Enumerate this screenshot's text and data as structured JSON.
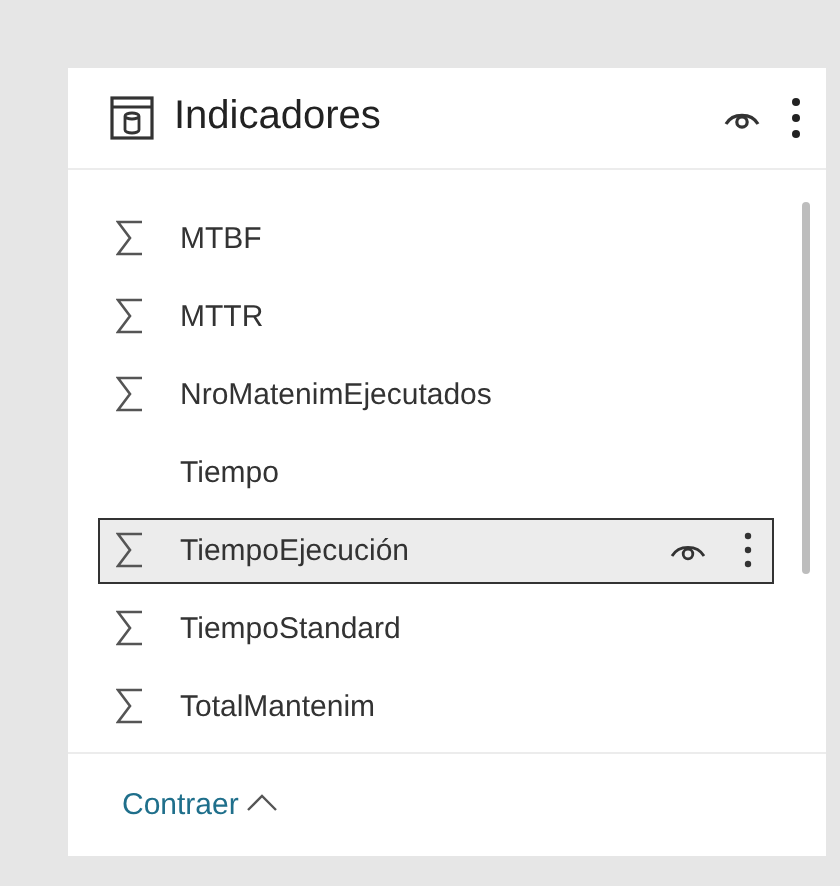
{
  "panel": {
    "title": "Indicadores"
  },
  "fields": [
    {
      "name": "MTBF",
      "kind": "measure",
      "selected": false
    },
    {
      "name": "MTTR",
      "kind": "measure",
      "selected": false
    },
    {
      "name": "NroMatenimEjecutados",
      "kind": "measure",
      "selected": false
    },
    {
      "name": "Tiempo",
      "kind": "column",
      "selected": false
    },
    {
      "name": "TiempoEjecución",
      "kind": "measure",
      "selected": true
    },
    {
      "name": "TiempoStandard",
      "kind": "measure",
      "selected": false
    },
    {
      "name": "TotalMantenim",
      "kind": "measure",
      "selected": false
    }
  ],
  "footer": {
    "link": "Contraer"
  }
}
